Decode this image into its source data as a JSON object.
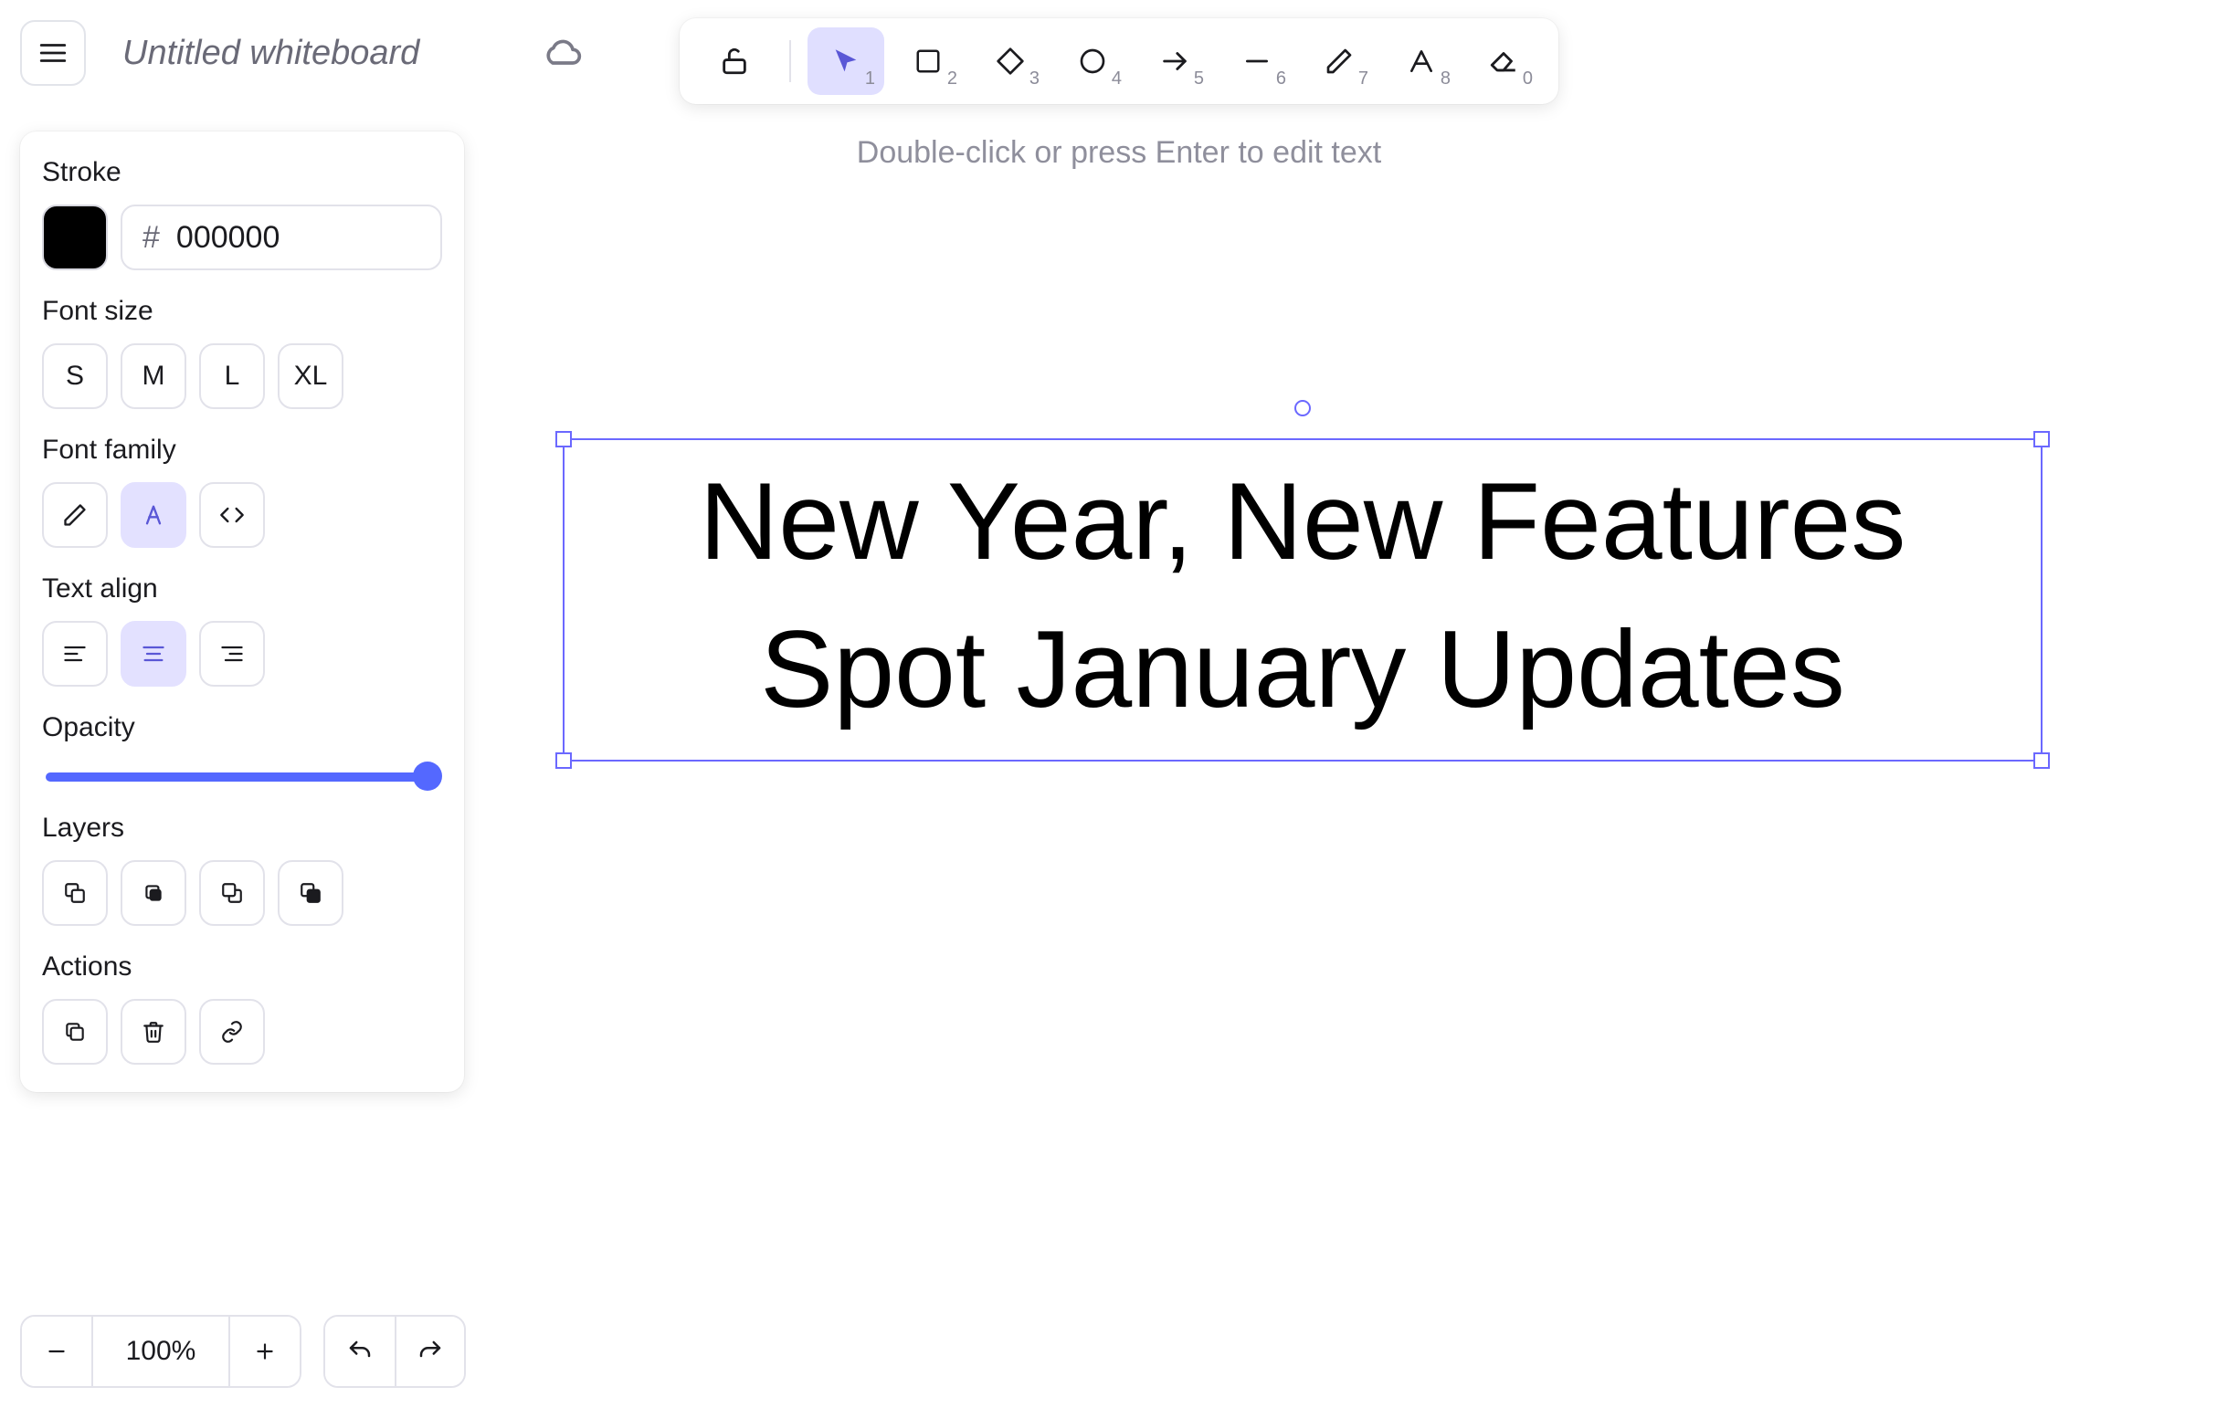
{
  "header": {
    "title": "Untitled whiteboard"
  },
  "toolbar": {
    "hint": "Double-click or press Enter to edit text",
    "lock_kbd": "",
    "select_kbd": "1",
    "rectangle_kbd": "2",
    "diamond_kbd": "3",
    "ellipse_kbd": "4",
    "arrow_kbd": "5",
    "line_kbd": "6",
    "draw_kbd": "7",
    "text_kbd": "8",
    "eraser_kbd": "0"
  },
  "panel": {
    "stroke_label": "Stroke",
    "stroke_hex": "000000",
    "hex_prefix": "#",
    "font_size_label": "Font size",
    "font_sizes": {
      "s": "S",
      "m": "M",
      "l": "L",
      "xl": "XL"
    },
    "font_family_label": "Font family",
    "text_align_label": "Text align",
    "opacity_label": "Opacity",
    "layers_label": "Layers",
    "actions_label": "Actions"
  },
  "canvas": {
    "text": "New Year, New Features\nSpot January Updates"
  },
  "footer": {
    "zoom": "100%"
  }
}
